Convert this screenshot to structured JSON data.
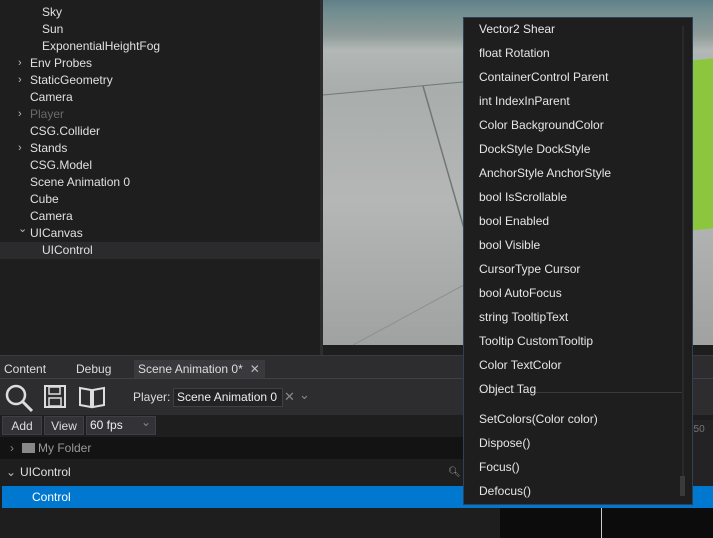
{
  "scene_tree": {
    "items": [
      {
        "label": "Sky",
        "indent": 2,
        "arrow": ""
      },
      {
        "label": "Sun",
        "indent": 2,
        "arrow": ""
      },
      {
        "label": "ExponentialHeightFog",
        "indent": 2,
        "arrow": ""
      },
      {
        "label": "Env Probes",
        "indent": 1,
        "arrow": "collapsed"
      },
      {
        "label": "StaticGeometry",
        "indent": 1,
        "arrow": "collapsed"
      },
      {
        "label": "Camera",
        "indent": 1,
        "arrow": ""
      },
      {
        "label": "Player",
        "indent": 1,
        "arrow": "collapsed",
        "disabled": true
      },
      {
        "label": "CSG.Collider",
        "indent": 1,
        "arrow": ""
      },
      {
        "label": "Stands",
        "indent": 1,
        "arrow": "collapsed"
      },
      {
        "label": "CSG.Model",
        "indent": 1,
        "arrow": ""
      },
      {
        "label": "Scene Animation 0",
        "indent": 1,
        "arrow": ""
      },
      {
        "label": "Cube",
        "indent": 1,
        "arrow": ""
      },
      {
        "label": "Camera",
        "indent": 1,
        "arrow": ""
      },
      {
        "label": "UICanvas",
        "indent": 1,
        "arrow": "expanded"
      },
      {
        "label": "UIControl",
        "indent": 2,
        "arrow": "",
        "selected": true
      }
    ]
  },
  "tabs": [
    {
      "label": "Content"
    },
    {
      "label": "Debug"
    },
    {
      "label": "Scene Animation 0*",
      "active": true
    }
  ],
  "toolbar": {
    "player_label": "Player:",
    "player_value": "Scene Animation 0",
    "add": "Add",
    "view": "View",
    "fps": "60 fps"
  },
  "tracks": {
    "folder": "My Folder",
    "uicontrol": "UIControl",
    "control": "Control"
  },
  "timeline": {
    "tick": "050"
  },
  "context_menu": {
    "items": [
      "Vector2 Shear",
      "float Rotation",
      "ContainerControl Parent",
      "int IndexInParent",
      "Color BackgroundColor",
      "DockStyle DockStyle",
      "AnchorStyle AnchorStyle",
      "bool IsScrollable",
      "bool Enabled",
      "bool Visible",
      "CursorType Cursor",
      "bool AutoFocus",
      "string TooltipText",
      "Tooltip CustomTooltip",
      "Color TextColor",
      "Object Tag"
    ],
    "methods": [
      "SetColors(Color color)",
      "Dispose()",
      "Focus()",
      "Defocus()"
    ]
  },
  "colors": {
    "selection": "#0078cf",
    "panel": "#1e1e1e"
  }
}
